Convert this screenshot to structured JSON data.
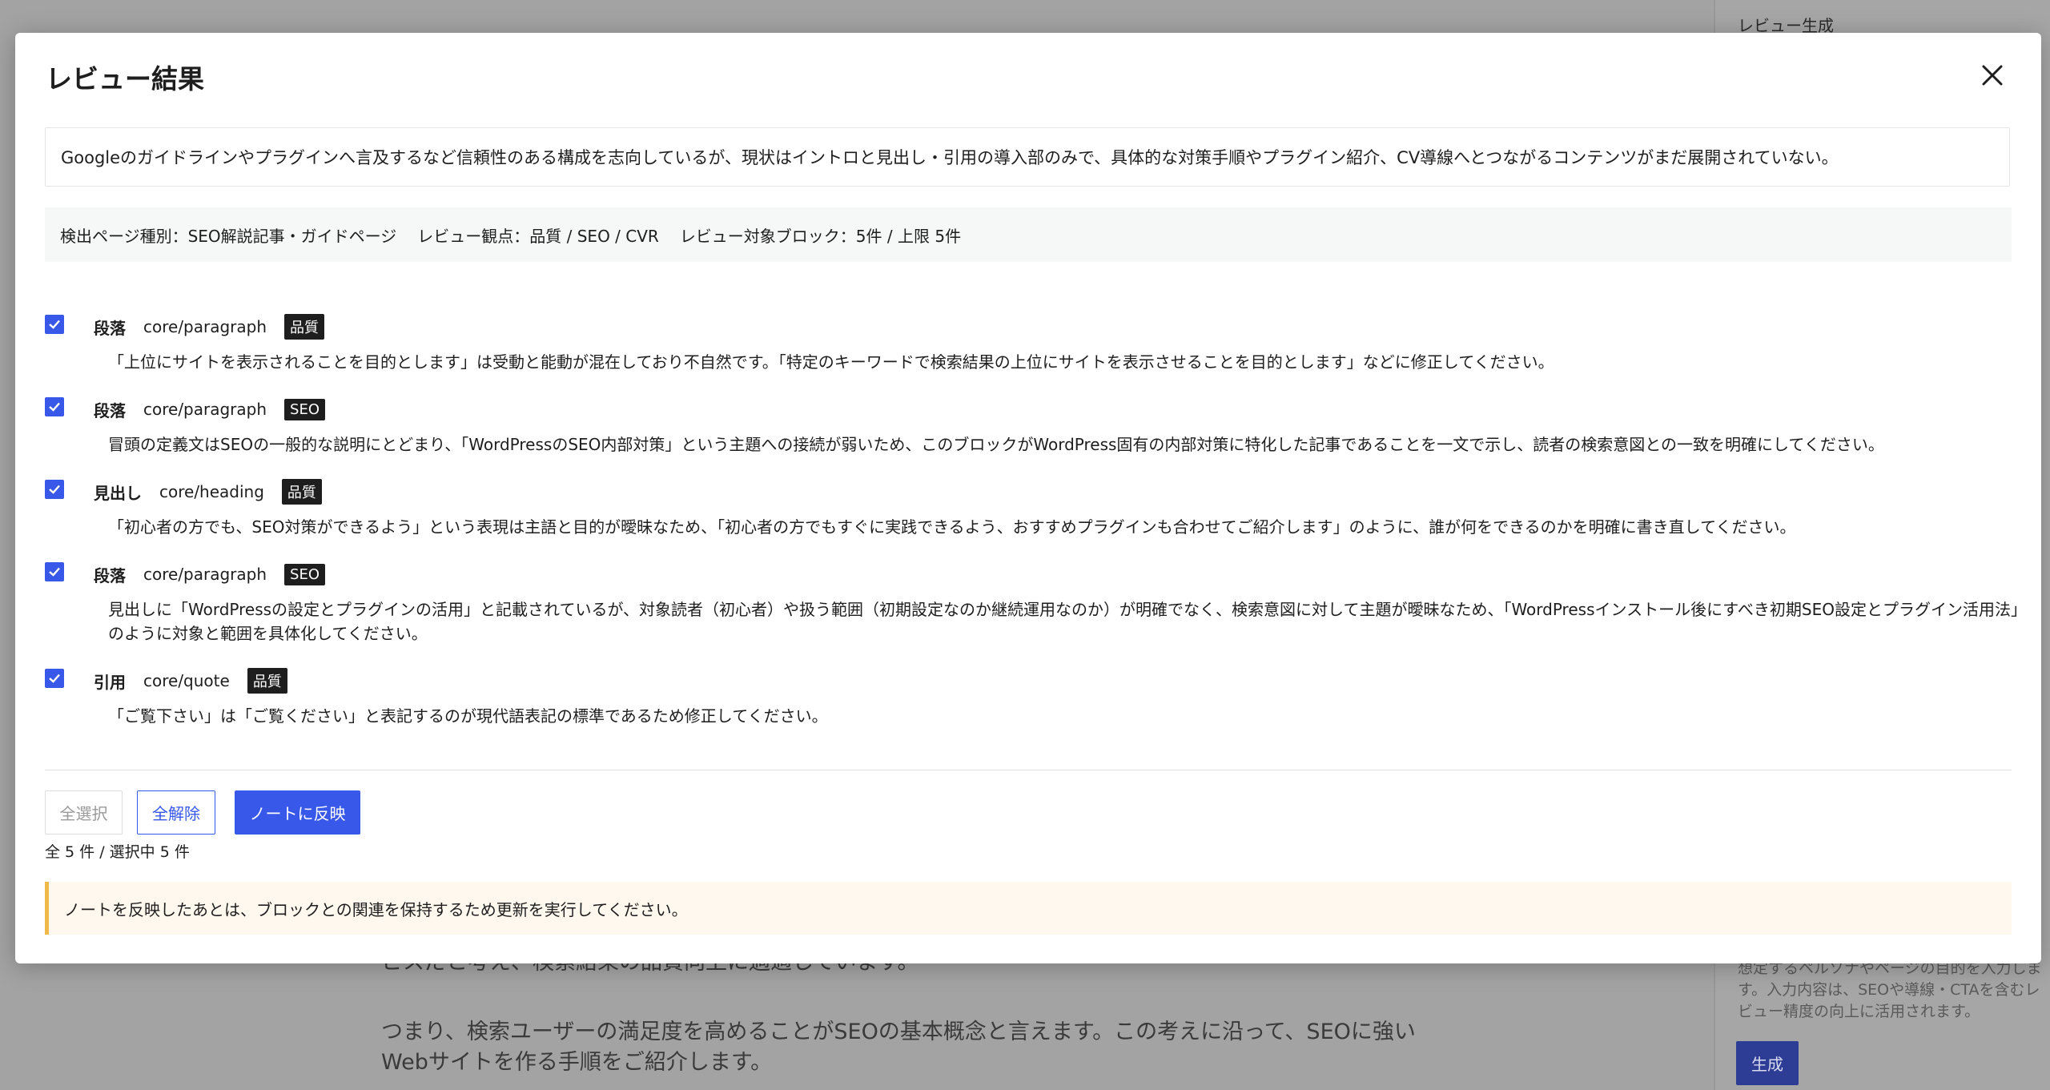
{
  "background": {
    "editor_lines": [
      "ビスだと考え、検索結果の品質向上に過適しています。",
      "つまり、検索ユーザーの満足度を高めることがSEOの基本概念と言えます。この考えに沿って、SEOに強い",
      "Webサイトを作る手順をご紹介します。"
    ],
    "sidebar": {
      "title": "レビュー生成",
      "help_text": "想定するペルソナやページの目的を入力しま す。入力内容は、SEOや導線・CTAを含むレ ビュー精度の向上に活用されます。",
      "generate_label": "生成"
    }
  },
  "modal": {
    "title": "レビュー結果",
    "summary": "Googleのガイドラインやプラグインへ言及するなど信頼性のある構成を志向しているが、現状はイントロと見出し・引用の導入部のみで、具体的な対策手順やプラグイン紹介、CV導線へとつながるコンテンツがまだ展開されていない。",
    "meta": {
      "page_type": "検出ページ種別：SEO解説記事・ガイドページ",
      "perspective": "レビュー観点：品質 / SEO / CVR",
      "target_blocks": "レビュー対象ブロック：5件 / 上限 5件"
    },
    "items": [
      {
        "label": "段落",
        "block": "core/paragraph",
        "tag": "品質",
        "checked": true,
        "lines": [
          "「上位にサイトを表示されることを目的とします」は受動と能動が混在しており不自然です。「特定のキーワードで検索結果の上位にサイトを表示させることを目的とします」などに修正してください。"
        ]
      },
      {
        "label": "段落",
        "block": "core/paragraph",
        "tag": "SEO",
        "checked": true,
        "lines": [
          "冒頭の定義文はSEOの一般的な説明にとどまり、「WordPressのSEO内部対策」という主題への接続が弱いため、このブロックがWordPress固有の内部対策に特化した記事であることを一文で示し、読者の検索意図との一致を明確にしてください。"
        ]
      },
      {
        "label": "見出し",
        "block": "core/heading",
        "tag": "品質",
        "checked": true,
        "lines": [
          "「初心者の方でも、SEO対策ができるよう」という表現は主語と目的が曖昧なため、「初心者の方でもすぐに実践できるよう、おすすめプラグインも合わせてご紹介します」のように、誰が何をできるのかを明確に書き直してください。"
        ]
      },
      {
        "label": "段落",
        "block": "core/paragraph",
        "tag": "SEO",
        "checked": true,
        "lines": [
          "見出しに「WordPressの設定とプラグインの活用」と記載されているが、対象読者（初心者）や扱う範囲（初期設定なのか継続運用なのか）が明確でなく、検索意図に対して主題が曖昧なため、「WordPressインストール後にすべき初期SEO設定とプラグイン活用法」",
          "のように対象と範囲を具体化してください。"
        ]
      },
      {
        "label": "引用",
        "block": "core/quote",
        "tag": "品質",
        "checked": true,
        "lines": [
          "「ご覧下さい」は「ご覧ください」と表記するのが現代語表記の標準であるため修正してください。"
        ]
      }
    ],
    "buttons": {
      "select_all": "全選択",
      "clear_all": "全解除",
      "apply": "ノートに反映"
    },
    "count_text": "全 5 件 / 選択中 5 件",
    "notice": "ノートを反映したあとは、ブロックとの関連を保持するため更新を実行してください。"
  }
}
